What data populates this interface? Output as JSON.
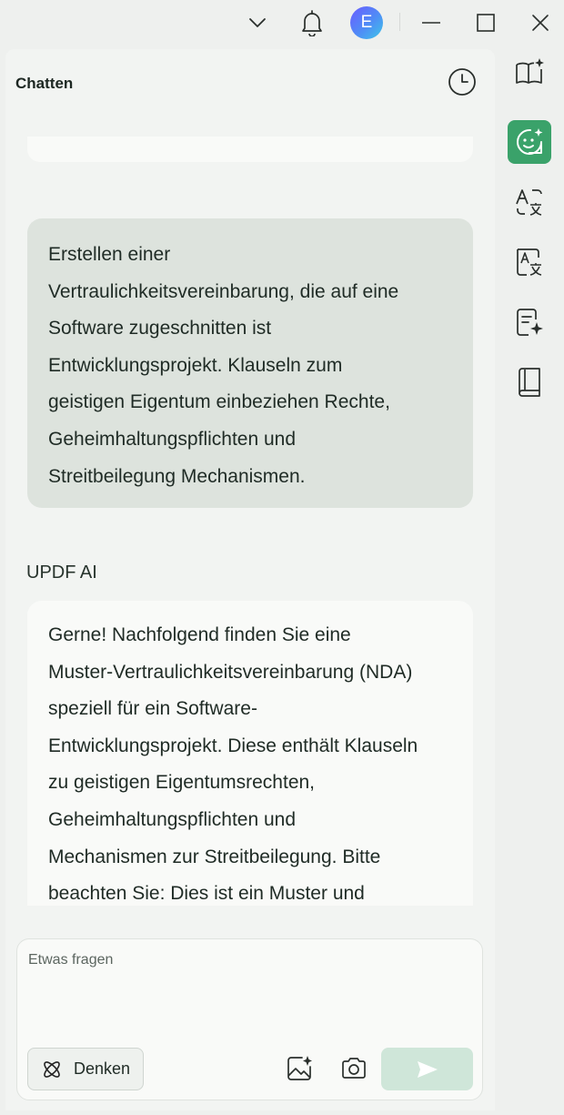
{
  "window": {
    "avatar_letter": "E",
    "icons": [
      "chevron-down-icon",
      "bell-icon",
      "minimize-icon",
      "maximize-icon",
      "close-icon"
    ]
  },
  "panel": {
    "title": "Chatten"
  },
  "messages": {
    "user_lines": [
      "Erstellen einer",
      "Vertraulichkeitsvereinbarung, die auf eine",
      "Software zugeschnitten ist",
      "Entwicklungsprojekt. Klauseln zum",
      "geistigen Eigentum einbeziehen Rechte,",
      "Geheimhaltungspflichten und",
      "Streitbeilegung Mechanismen."
    ],
    "ai_label": "UPDF AI",
    "ai_lines": [
      "Gerne! Nachfolgend finden Sie eine",
      "Muster-Vertraulichkeitsvereinbarung (NDA)",
      "speziell für ein Software-",
      "Entwicklungsprojekt. Diese enthält Klauseln",
      "zu geistigen Eigentumsrechten,",
      "Geheimhaltungspflichten und",
      "Mechanismen zur Streitbeilegung. Bitte",
      "beachten Sie: Dies ist ein Muster und"
    ]
  },
  "input": {
    "placeholder": "Etwas fragen",
    "value": "",
    "think_label": "Denken"
  },
  "colors": {
    "accent": "#3aa26a",
    "send_disabled": "#cfe6d9",
    "user_bubble": "#dde3dd",
    "ai_bubble": "#f9faf8"
  },
  "rail": {
    "items": [
      "book-sparkle-icon",
      "chat-bot-icon",
      "translate-icon",
      "spell-check-icon",
      "summary-icon",
      "knowledge-book-icon"
    ],
    "active": "chat-bot-icon"
  }
}
